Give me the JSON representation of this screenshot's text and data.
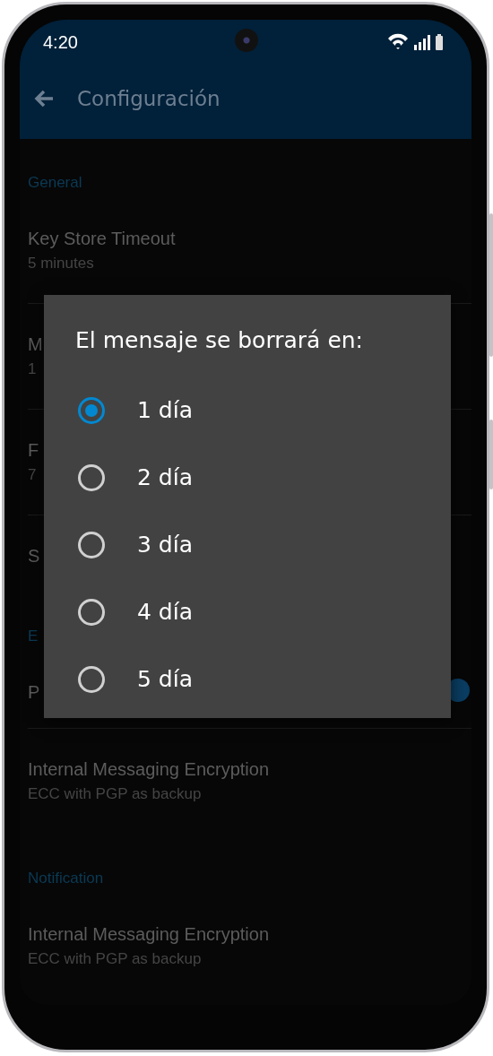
{
  "status_bar": {
    "time": "4:20"
  },
  "app_bar": {
    "title": "Configuración"
  },
  "settings": [
    {
      "kind": "section",
      "label": "General"
    },
    {
      "kind": "item",
      "title": "Key Store Timeout",
      "subtitle": "5 minutes",
      "divider": true
    },
    {
      "kind": "item",
      "title": "M",
      "subtitle": "1",
      "divider": true
    },
    {
      "kind": "item",
      "title": "F",
      "subtitle": "7",
      "divider": true
    },
    {
      "kind": "item",
      "title": "S",
      "divider": false
    },
    {
      "kind": "section",
      "label": "E"
    },
    {
      "kind": "item",
      "title": "P",
      "divider": true,
      "toggle_on": true
    },
    {
      "kind": "item",
      "title": "Internal Messaging Encryption",
      "subtitle": "ECC with PGP as backup",
      "divider": false
    },
    {
      "kind": "section",
      "label": "Notification"
    },
    {
      "kind": "item",
      "title": "Internal Messaging Encryption",
      "subtitle": "ECC with PGP as backup",
      "divider": false
    }
  ],
  "dialog": {
    "title": "El mensaje se borrará en:",
    "options": [
      {
        "label": "1 día",
        "selected": true
      },
      {
        "label": "2 día",
        "selected": false
      },
      {
        "label": "3 día",
        "selected": false
      },
      {
        "label": "4 día",
        "selected": false
      },
      {
        "label": "5 día",
        "selected": false
      }
    ]
  }
}
